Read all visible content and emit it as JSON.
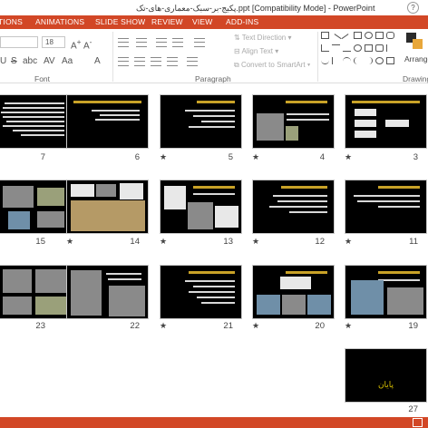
{
  "window": {
    "title": "پکیج-بر-سبک-معماری-های-تک.ppt [Compatibility Mode] - PowerPoint",
    "help": "?"
  },
  "tabs": [
    "TIONS",
    "ANIMATIONS",
    "SLIDE SHOW",
    "REVIEW",
    "VIEW",
    "ADD-INS"
  ],
  "ribbon": {
    "font_size": "18",
    "groups": {
      "font": "Font",
      "paragraph": "Paragraph",
      "drawing": "Drawing"
    },
    "text_direction": "Text Direction",
    "align_text": "Align Text",
    "convert_smartart": "Convert to SmartArt",
    "arrange": "Arrange"
  },
  "slides": [
    {
      "num": "7",
      "star": false,
      "kind": "text-dense"
    },
    {
      "num": "6",
      "star": false,
      "kind": "text"
    },
    {
      "num": "5",
      "star": true,
      "kind": "text"
    },
    {
      "num": "4",
      "star": true,
      "kind": "text-image"
    },
    {
      "num": "3",
      "star": true,
      "kind": "diagram"
    },
    {
      "num": "15",
      "star": false,
      "kind": "photos"
    },
    {
      "num": "14",
      "star": true,
      "kind": "photos"
    },
    {
      "num": "13",
      "star": false,
      "kind": "photos"
    },
    {
      "num": "12",
      "star": true,
      "kind": "text"
    },
    {
      "num": "11",
      "star": true,
      "kind": "text"
    },
    {
      "num": "23",
      "star": false,
      "kind": "photos"
    },
    {
      "num": "22",
      "star": false,
      "kind": "building"
    },
    {
      "num": "21",
      "star": true,
      "kind": "text"
    },
    {
      "num": "20",
      "star": true,
      "kind": "photos"
    },
    {
      "num": "19",
      "star": true,
      "kind": "photos"
    },
    {
      "num": "27",
      "star": false,
      "kind": "end",
      "end_text": "پایان"
    }
  ],
  "colors": {
    "accent": "#d24726",
    "slide_bg": "#000000",
    "slide_title": "#c9a227"
  }
}
